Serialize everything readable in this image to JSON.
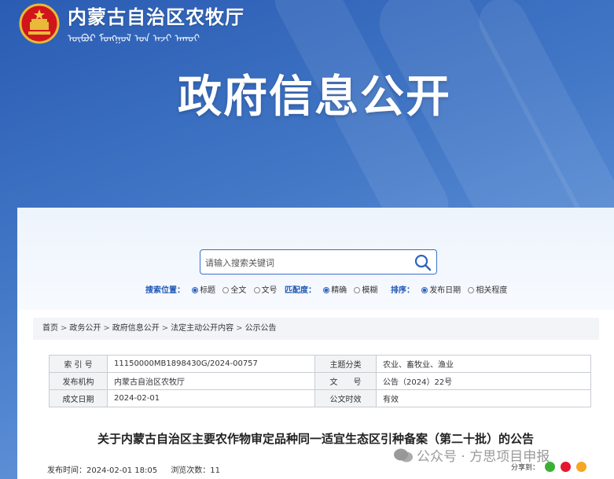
{
  "header": {
    "site_title": "内蒙古自治区农牧厅",
    "site_title_mongolian": "ᠥᠪᠦᠷ ᠮᠣᠩᠭᠣᠯ ᠤᠨ ᠠᠵᠢ ᠠᠬᠤᠢ",
    "banner_title": "政府信息公开"
  },
  "search": {
    "placeholder": "请输入搜索关键词",
    "value": ""
  },
  "filters": {
    "position": {
      "label": "搜索位置：",
      "options": [
        "标题",
        "全文",
        "文号"
      ],
      "selected": "标题"
    },
    "match": {
      "label": "匹配度：",
      "options": [
        "精确",
        "模糊"
      ],
      "selected": "精确"
    },
    "sort": {
      "label": "排序：",
      "options": [
        "发布日期",
        "相关程度"
      ],
      "selected": "发布日期"
    }
  },
  "breadcrumb": [
    "首页",
    "政务公开",
    "政府信息公开",
    "法定主动公开内容",
    "公示公告"
  ],
  "meta": {
    "index_label": "索 引 号",
    "index_value": "11150000MB1898430G/2024-00757",
    "topic_label": "主题分类",
    "topic_value": "农业、畜牧业、渔业",
    "org_label": "发布机构",
    "org_value": "内蒙古自治区农牧厅",
    "docno_label": "文　　号",
    "docno_value": "公告（2024）22号",
    "date_label": "成文日期",
    "date_value": "2024-02-01",
    "status_label": "公文时效",
    "status_value": "有效"
  },
  "document": {
    "title": "关于内蒙古自治区主要农作物审定品种同一适宜生态区引种备案（第二十批）的公告",
    "publish_time": "发布时间：2024-02-01 18:05",
    "views": "浏览次数：11",
    "share_label": "分享到："
  },
  "watermark": {
    "text": "公众号 · 方思项目申报"
  },
  "colors": {
    "accent": "#1f57b5",
    "banner": "#3a6dc0"
  }
}
